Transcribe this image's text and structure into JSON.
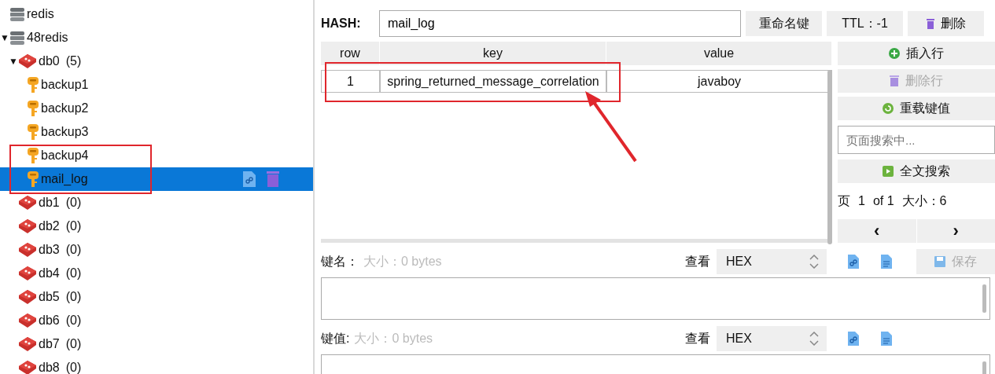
{
  "tree": [
    {
      "kind": "connection",
      "name": "redis"
    },
    {
      "kind": "connection",
      "name": "48redis",
      "toggle": "▼",
      "children": [
        {
          "kind": "database",
          "name": "db0",
          "count": "(5)",
          "toggle": "▼",
          "children": [
            {
              "kind": "key",
              "name": "backup1",
              "selected": false
            },
            {
              "kind": "key",
              "name": "backup2",
              "selected": false
            },
            {
              "kind": "key",
              "name": "backup3",
              "selected": false
            },
            {
              "kind": "key",
              "name": "backup4",
              "selected": false
            },
            {
              "kind": "key",
              "name": "mail_log",
              "selected": true
            }
          ]
        },
        {
          "kind": "database",
          "name": "db1",
          "count": "(0)"
        },
        {
          "kind": "database",
          "name": "db2",
          "count": "(0)"
        },
        {
          "kind": "database",
          "name": "db3",
          "count": "(0)"
        },
        {
          "kind": "database",
          "name": "db4",
          "count": "(0)"
        },
        {
          "kind": "database",
          "name": "db5",
          "count": "(0)"
        },
        {
          "kind": "database",
          "name": "db6",
          "count": "(0)"
        },
        {
          "kind": "database",
          "name": "db7",
          "count": "(0)"
        },
        {
          "kind": "database",
          "name": "db8",
          "count": "(0)"
        }
      ]
    }
  ],
  "key_header": {
    "type_label": "HASH:",
    "key_name": "mail_log",
    "rename_button": "重命名键",
    "ttl_button": "TTL：-1",
    "delete_button": "删除"
  },
  "table": {
    "columns": [
      "row",
      "key",
      "value"
    ],
    "rows": [
      {
        "cells": [
          "1",
          "spring_returned_message_correlation",
          "javaboy"
        ]
      }
    ]
  },
  "side": {
    "buttons": [
      {
        "label": "插入行",
        "disabled": false
      },
      {
        "label": "删除行",
        "disabled": true
      },
      {
        "label": "重载键值",
        "disabled": false
      }
    ],
    "search": {
      "placeholder": "页面搜索中..."
    },
    "search_button": "全文搜索",
    "page_label": "页",
    "page": "1",
    "of": "of 1",
    "size": "大小：6",
    "prev": "‹",
    "next": "›"
  },
  "editors": [
    {
      "label": "键名：",
      "size": "大小：0 bytes",
      "view_label": "查看",
      "format": "HEX",
      "save_button": "保存",
      "save_disabled": true
    },
    {
      "label": "键值:",
      "size": "大小：0 bytes",
      "view_label": "查看",
      "format": "HEX"
    }
  ]
}
